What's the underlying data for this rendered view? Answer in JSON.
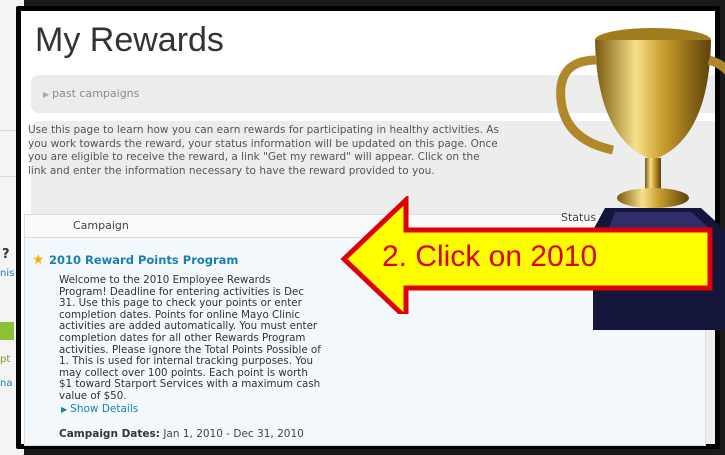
{
  "background_app": {
    "question_mark": "?",
    "fragments": [
      "nis",
      "pt",
      "na"
    ]
  },
  "page": {
    "title": "My Rewards",
    "past_campaigns_link": "past campaigns",
    "intro": "Use this page to learn how you can earn rewards for participating in healthy activities. As you work towards the reward, your status information will be updated on this page. Once you are eligible to receive the reward, a link \"Get my reward\" will appear. Click on the link and enter the information necessary to have the reward provided to you."
  },
  "table": {
    "headers": {
      "campaign": "Campaign",
      "status": "Status"
    },
    "rows": [
      {
        "title": "2010 Reward Points Program",
        "description": "Welcome to the 2010 Employee Rewards Program! Deadline for entering activities is Dec 31. Use this page to check your points or enter completion dates. Points for online Mayo Clinic activities are added automatically. You must enter completion dates for all other Rewards Program activities. Please ignore the Total Points Possible of 1. This is used for internal tracking purposes. You may collect over 100 points. Each point is worth $1 toward Starport Services with a maximum cash value of $50.",
        "show_details": "Show Details",
        "dates_label": "Campaign Dates:",
        "dates_value": " Jan 1, 2010 - Dec 31, 2010"
      }
    ]
  },
  "callout": {
    "text": "2. Click on 2010",
    "fill_color": "#ffff00",
    "border_color": "#e00000"
  }
}
